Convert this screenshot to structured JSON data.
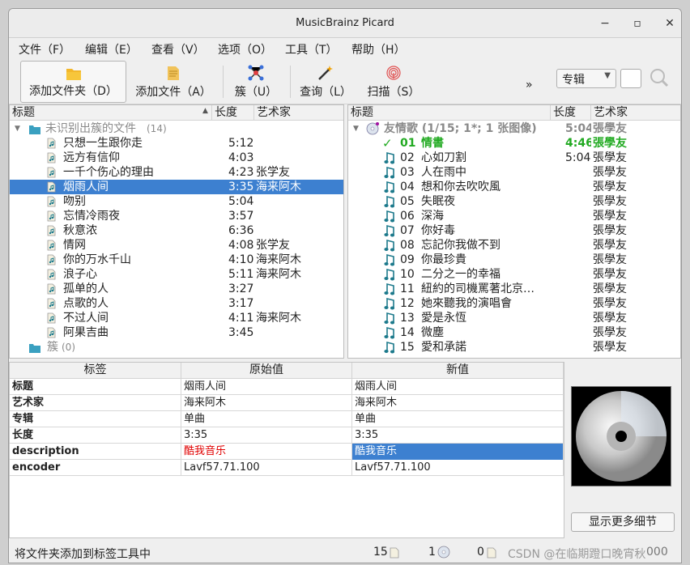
{
  "window": {
    "title": "MusicBrainz Picard"
  },
  "menu": [
    "文件（F）",
    "编辑（E）",
    "查看（V）",
    "选项（O）",
    "工具（T）",
    "帮助（H）"
  ],
  "toolbar": {
    "add_folder": "添加文件夹（D）",
    "add_files": "添加文件（A）",
    "cluster": "簇（U）",
    "lookup": "查询（L）",
    "scan": "扫描（S）",
    "more": "»",
    "mode": "专辑"
  },
  "left": {
    "headers": [
      "标题",
      "长度",
      "艺术家"
    ],
    "group": {
      "label": "未识别出簇的文件",
      "count": "(14)"
    },
    "files": [
      {
        "title": "只想一生跟你走",
        "length": "5:12",
        "artist": ""
      },
      {
        "title": "远方有信仰",
        "length": "4:03",
        "artist": ""
      },
      {
        "title": "一千个伤心的理由",
        "length": "4:23",
        "artist": "张学友"
      },
      {
        "title": "烟雨人间",
        "length": "3:35",
        "artist": "海来阿木",
        "selected": true
      },
      {
        "title": "吻别",
        "length": "5:04",
        "artist": ""
      },
      {
        "title": "忘情冷雨夜",
        "length": "3:57",
        "artist": ""
      },
      {
        "title": "秋意浓",
        "length": "6:36",
        "artist": ""
      },
      {
        "title": "情网",
        "length": "4:08",
        "artist": "张学友"
      },
      {
        "title": "你的万水千山",
        "length": "4:10",
        "artist": "海来阿木"
      },
      {
        "title": "浪子心",
        "length": "5:11",
        "artist": "海来阿木"
      },
      {
        "title": "孤单的人",
        "length": "3:27",
        "artist": ""
      },
      {
        "title": "点歌的人",
        "length": "3:17",
        "artist": ""
      },
      {
        "title": "不过人间",
        "length": "4:11",
        "artist": "海来阿木"
      },
      {
        "title": "阿果吉曲",
        "length": "3:45",
        "artist": ""
      }
    ],
    "cluster": {
      "label": "簇",
      "count": "(0)"
    }
  },
  "right": {
    "headers": [
      "标题",
      "长度",
      "艺术家"
    ],
    "album": {
      "title": "友情歌 (1/15; 1*; 1 张图像)",
      "length": "5:04",
      "artist": "張學友"
    },
    "tracks": [
      {
        "num": "01",
        "title": "情書",
        "length": "4:46",
        "artist": "張學友",
        "matched": true
      },
      {
        "num": "02",
        "title": "心如刀割",
        "length": "5:04",
        "artist": "張學友"
      },
      {
        "num": "03",
        "title": "人在雨中",
        "length": "",
        "artist": "張學友"
      },
      {
        "num": "04",
        "title": "想和你去吹吹風",
        "length": "",
        "artist": "張學友"
      },
      {
        "num": "05",
        "title": "失眠夜",
        "length": "",
        "artist": "張學友"
      },
      {
        "num": "06",
        "title": "深海",
        "length": "",
        "artist": "張學友"
      },
      {
        "num": "07",
        "title": "你好毒",
        "length": "",
        "artist": "張學友"
      },
      {
        "num": "08",
        "title": "忘記你我做不到",
        "length": "",
        "artist": "張學友"
      },
      {
        "num": "09",
        "title": "你最珍貴",
        "length": "",
        "artist": "張學友"
      },
      {
        "num": "10",
        "title": "二分之一的幸福",
        "length": "",
        "artist": "張學友"
      },
      {
        "num": "11",
        "title": "紐約的司機罵著北京…",
        "length": "",
        "artist": "張學友"
      },
      {
        "num": "12",
        "title": "她來聽我的演唱會",
        "length": "",
        "artist": "張學友"
      },
      {
        "num": "13",
        "title": "愛是永恆",
        "length": "",
        "artist": "張學友"
      },
      {
        "num": "14",
        "title": "微塵",
        "length": "",
        "artist": "張學友"
      },
      {
        "num": "15",
        "title": "愛和承諾",
        "length": "",
        "artist": "張學友"
      }
    ]
  },
  "metadata": {
    "headers": [
      "标签",
      "原始值",
      "新值"
    ],
    "rows": [
      {
        "tag": "标题",
        "orig": "烟雨人间",
        "new": "烟雨人间"
      },
      {
        "tag": "艺术家",
        "orig": "海来阿木",
        "new": "海来阿木"
      },
      {
        "tag": "专辑",
        "orig": "单曲",
        "new": "单曲"
      },
      {
        "tag": "长度",
        "orig": "3:35",
        "new": "3:35"
      },
      {
        "tag": "description",
        "orig": "酷我音乐",
        "new": "酷我音乐",
        "changed": true
      },
      {
        "tag": "encoder",
        "orig": "Lavf57.71.100",
        "new": "Lavf57.71.100"
      }
    ]
  },
  "more_details": "显示更多细节",
  "status": {
    "message": "将文件夹添加到标签工具中",
    "files": "15",
    "albums": "1",
    "pending": "0",
    "watermark": "CSDN @在临期蹬口晚宵秋",
    "tail": "000"
  },
  "colors": {
    "selection": "#3d80d0",
    "matched": "#22aa22",
    "changed": "#e00000",
    "note": "#1d7a8c"
  }
}
